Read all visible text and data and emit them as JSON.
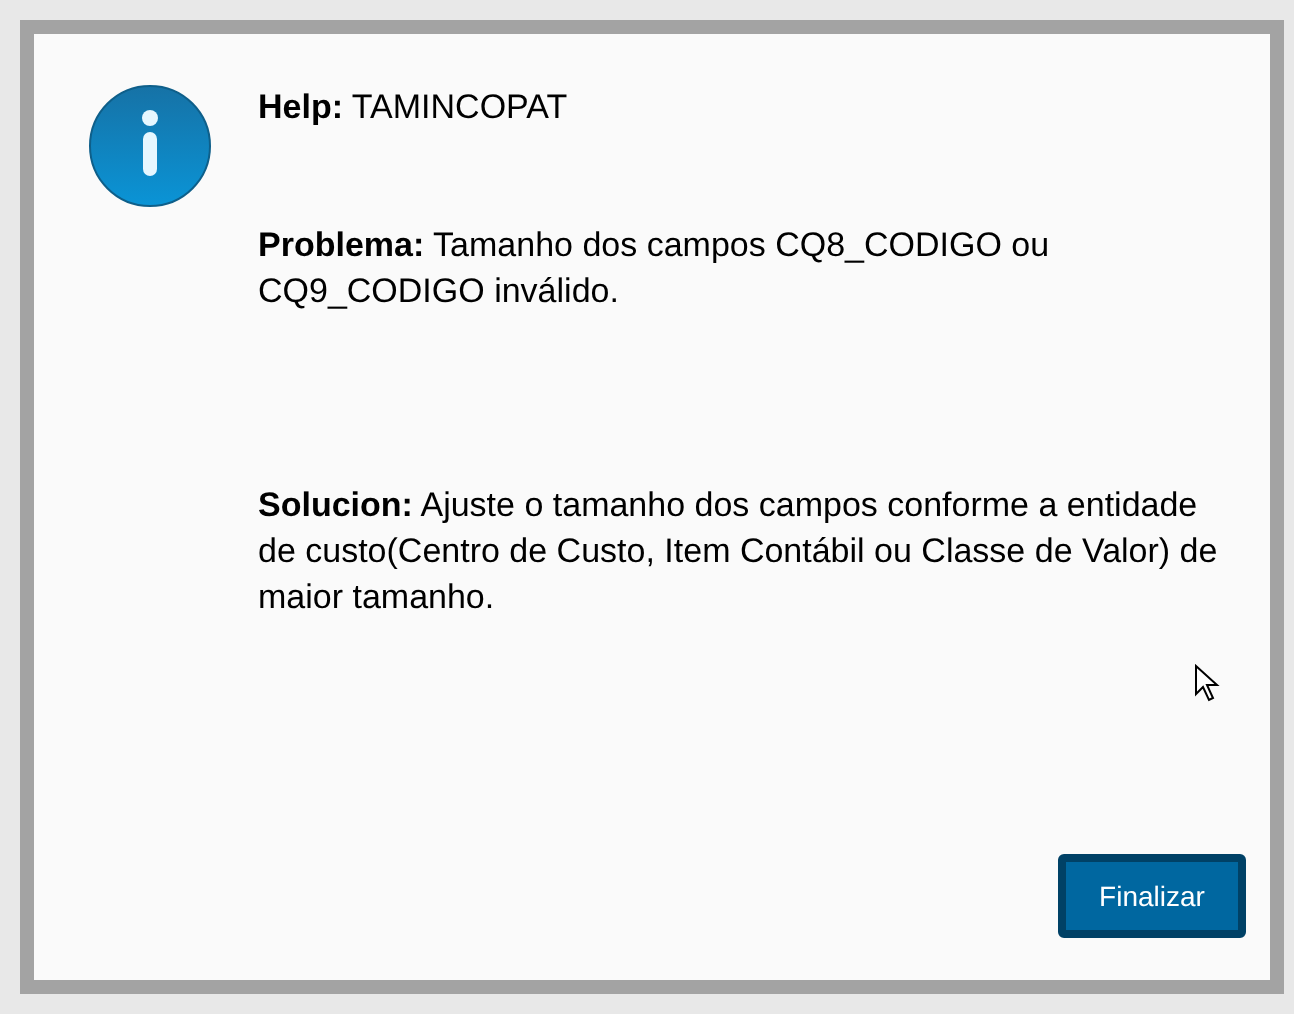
{
  "messages": [
    {
      "text": "**Help:** TAMINCOPAT"
    },
    {
      "text": "**Problema:** Tamanho dos campos CQ8_CODIGO ou CQ9_CODIGO inválido."
    },
    {
      "text": "**Solucion:** Ajuste o tamanho dos campos conforme a entidade de custo(Centro de Custo, Item Contábil ou Classe de Valor) de maior tamanho."
    }
  ],
  "buttons": [
    {
      "label": "Finalizar"
    }
  ]
}
